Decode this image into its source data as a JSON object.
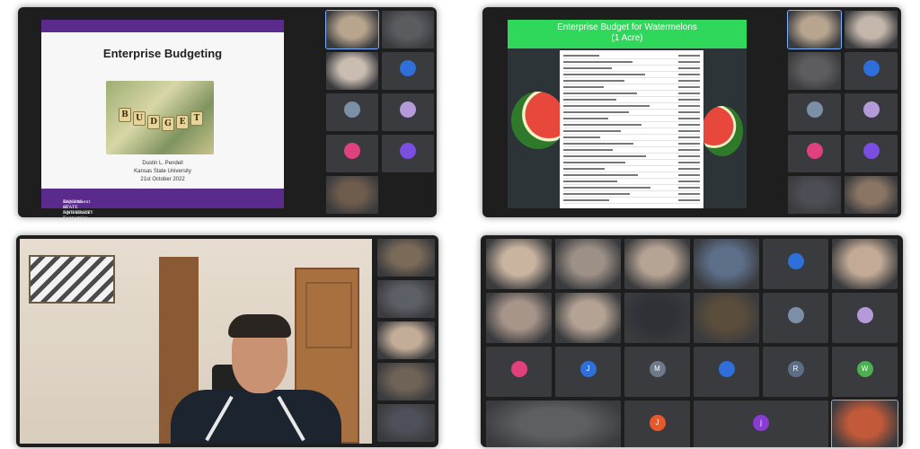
{
  "panel1": {
    "slide": {
      "title": "Enterprise Budgeting",
      "budget_letters": [
        "B",
        "U",
        "D",
        "G",
        "E",
        "T"
      ],
      "author": "Dustin L. Pendell",
      "university": "Kansas State University",
      "date": "21st October 2022",
      "footer_logo": "KANSAS STATE UNIVERSITY",
      "footer_dept": "Department of Agricultural Economics"
    },
    "tiles": [
      {
        "type": "video",
        "name": "",
        "color": "#b8a58e",
        "active": true
      },
      {
        "type": "video",
        "name": "",
        "color": "#5b5c60"
      },
      {
        "type": "video",
        "name": "",
        "color": "#c9bcb1"
      },
      {
        "type": "avatar",
        "name": "",
        "initials": "",
        "color": "#2e6fd9"
      },
      {
        "type": "avatar",
        "name": "",
        "initials": "",
        "color": "#7b8fa6"
      },
      {
        "type": "avatar",
        "name": "",
        "initials": "",
        "color": "#b49ad8"
      },
      {
        "type": "avatar",
        "name": "",
        "initials": "",
        "color": "#e0407e"
      },
      {
        "type": "avatar",
        "name": "",
        "initials": "",
        "color": "#7a4ee0"
      },
      {
        "type": "video",
        "name": "",
        "color": "#6e5c4c"
      }
    ]
  },
  "panel2": {
    "slide": {
      "title": "Enterprise Budget for Watermelons",
      "subtitle": "(1 Acre)"
    },
    "tiles": [
      {
        "type": "video",
        "name": "",
        "color": "#b7a590",
        "active": true
      },
      {
        "type": "video",
        "name": "",
        "color": "#c4b6aa"
      },
      {
        "type": "video",
        "name": "",
        "color": "#5d5d60"
      },
      {
        "type": "avatar",
        "name": "",
        "initials": "",
        "color": "#2e6fd9"
      },
      {
        "type": "avatar",
        "name": "",
        "initials": "",
        "color": "#7b8fa6"
      },
      {
        "type": "avatar",
        "name": "",
        "initials": "",
        "color": "#b49ad8"
      },
      {
        "type": "avatar",
        "name": "",
        "initials": "",
        "color": "#e0407e"
      },
      {
        "type": "avatar",
        "name": "",
        "initials": "",
        "color": "#7a4ee0"
      },
      {
        "type": "video",
        "name": "",
        "color": "#4c4e55"
      },
      {
        "type": "video",
        "name": "",
        "color": "#8a7564"
      }
    ]
  },
  "panel3": {
    "tiles": [
      {
        "type": "video",
        "name": "",
        "color": "#7a6a58"
      },
      {
        "type": "video",
        "name": "",
        "color": "#5c5f66"
      },
      {
        "type": "video",
        "name": "",
        "color": "#c4ad98"
      },
      {
        "type": "video",
        "name": "",
        "color": "#6f6257"
      },
      {
        "type": "video",
        "name": "",
        "color": "#4d5058"
      }
    ]
  },
  "panel4": {
    "tiles": [
      {
        "type": "video",
        "name": "",
        "color": "#c9b4a0"
      },
      {
        "type": "video",
        "name": "",
        "color": "#9c9087"
      },
      {
        "type": "video",
        "name": "",
        "color": "#b5a394"
      },
      {
        "type": "video",
        "name": "",
        "color": "#5d6f89"
      },
      {
        "type": "avatar",
        "name": "",
        "initials": "",
        "color": "#2e6fd9"
      },
      {
        "type": "video",
        "name": "",
        "color": "#c2aa96"
      },
      {
        "type": "video",
        "name": "",
        "color": "#a8958a"
      },
      {
        "type": "video",
        "name": "",
        "color": "#b4a395"
      },
      {
        "type": "video",
        "name": "",
        "color": "#2f3136"
      },
      {
        "type": "video",
        "name": "",
        "color": "#5b4d3c"
      },
      {
        "type": "avatar",
        "name": "",
        "initials": "",
        "color": "#7b8fa6"
      },
      {
        "type": "avatar",
        "name": "",
        "initials": "",
        "color": "#b49ad8"
      },
      {
        "type": "avatar",
        "name": "",
        "initials": "",
        "color": "#e0407e"
      },
      {
        "type": "avatar",
        "name": "",
        "initials": "J",
        "color": "#2e6fd9"
      },
      {
        "type": "avatar",
        "name": "",
        "initials": "M",
        "color": "#6e7a8a"
      },
      {
        "type": "avatar",
        "name": "",
        "initials": "",
        "color": "#2e6fd9"
      },
      {
        "type": "avatar",
        "name": "",
        "initials": "R",
        "color": "#5e6e84"
      },
      {
        "type": "avatar",
        "name": "",
        "initials": "W",
        "color": "#4caf50"
      },
      {
        "type": "video",
        "name": "",
        "color": "#5d5f63",
        "span": 2
      },
      {
        "type": "avatar",
        "name": "",
        "initials": "J",
        "color": "#e8582b",
        "span": 1
      },
      {
        "type": "avatar",
        "name": "",
        "initials": "j",
        "color": "#8a3bd1",
        "span": 2
      },
      {
        "type": "video",
        "name": "",
        "color": "#c25a3a",
        "active": true
      }
    ]
  }
}
